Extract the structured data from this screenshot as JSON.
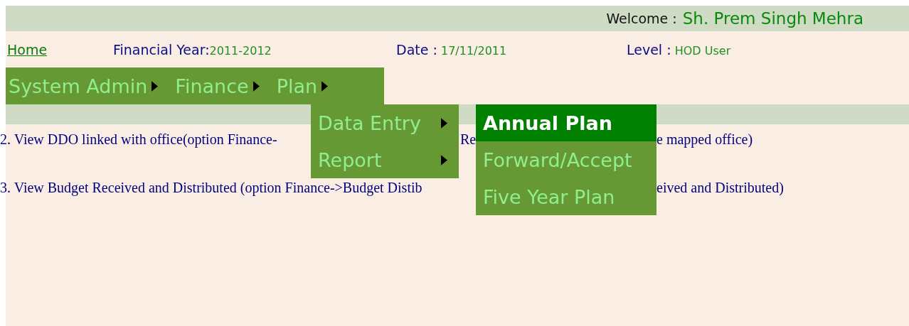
{
  "header": {
    "welcome_label": "Welcome :",
    "user_name": "Sh. Prem Singh Mehra"
  },
  "info": {
    "home_link": "Home",
    "financial_year_label": "Financial Year:",
    "financial_year": "2011-2012",
    "date_label": "Date :",
    "date": "17/11/2011",
    "level_label": "Level :",
    "level": "HOD User"
  },
  "menu_bar": [
    {
      "label": "System Admin"
    },
    {
      "label": "Finance"
    },
    {
      "label": "Plan"
    }
  ],
  "submenu": [
    {
      "label": "Data Entry"
    },
    {
      "label": "Report"
    }
  ],
  "plan_submenu": [
    {
      "label": "Annual Plan",
      "selected": true
    },
    {
      "label": "Forward/Accept",
      "selected": false
    },
    {
      "label": "Five Year Plan",
      "selected": false
    }
  ],
  "content_lines": [
    {
      "fragments": [
        "2. View DDO linked with office(option Finance-",
        "Re",
        "e mapped office)"
      ]
    },
    {
      "fragments": [
        "3. View Budget Received and Distributed (option Finance->Budget Distib",
        "eived and Distributed)"
      ]
    }
  ]
}
